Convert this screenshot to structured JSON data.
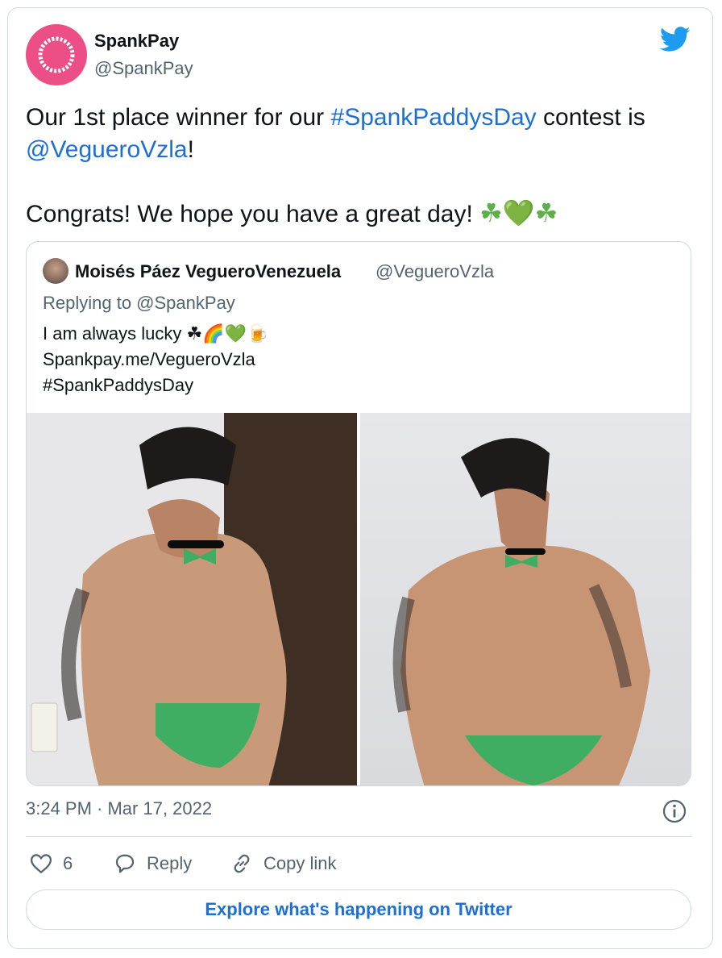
{
  "author": {
    "name": "SpankPay",
    "handle": "@SpankPay"
  },
  "tweet": {
    "pre": "Our 1st place winner for our ",
    "hashtag": "#SpankPaddysDay",
    "mid": " contest is",
    "mention": "@VegueroVzla",
    "post": "!",
    "line2": "Congrats! We hope you have a great day! ",
    "emoji": [
      "☘",
      "💚",
      "☘"
    ]
  },
  "quoted": {
    "name": "Moisés Páez VegueroVenezuela",
    "handle": "@VegueroVzla",
    "replying": "Replying to @SpankPay",
    "line1": "I am always lucky ",
    "line1_emoji": "☘🌈💚🍺",
    "line2": "Spankpay.me/VegueroVzla",
    "line3": "#SpankPaddysDay"
  },
  "meta": {
    "timestamp": "3:24 PM · Mar 17, 2022"
  },
  "actions": {
    "likes": "6",
    "reply": "Reply",
    "copy": "Copy link"
  },
  "explore": "Explore what's happening on Twitter",
  "colors": {
    "link": "#1d6fd6",
    "avatar": "#ec4f86",
    "twitter_blue": "#1d9bf0",
    "green": "#3fae62"
  },
  "icons": [
    "twitter-bird-icon",
    "info-icon",
    "heart-icon",
    "reply-bubble-icon",
    "link-icon"
  ]
}
